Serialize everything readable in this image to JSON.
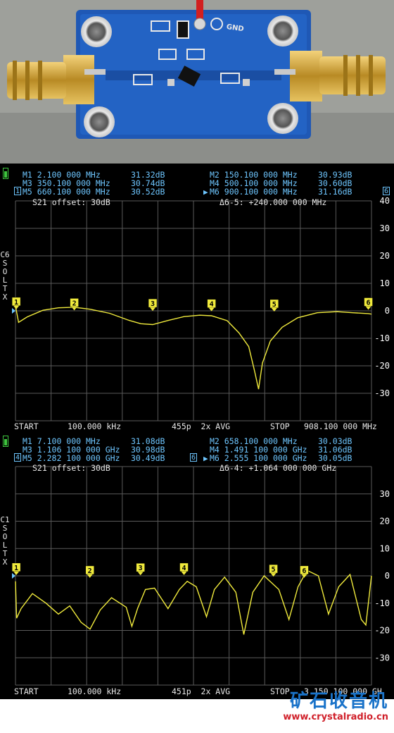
{
  "photo": {
    "pcb_label": "GND",
    "colors": {
      "board": "#1f58b5",
      "connector": "#c9a23a",
      "background": "#9d9f9b"
    }
  },
  "watermark": {
    "name": "矿石收音机",
    "url": "www.crystalradio.cn"
  },
  "screens": [
    {
      "markers_text": [
        {
          "label": "M1 2.100 000 MHz",
          "value": "31.32dB"
        },
        {
          "label": "M2 150.100 000 MHz",
          "value": "30.93dB"
        },
        {
          "label": "M3 350.100 000 MHz",
          "value": "30.74dB"
        },
        {
          "label": "M4 500.100 000 MHz",
          "value": "30.60dB"
        },
        {
          "label": "M5 660.100 000 MHz",
          "value": "30.52dB"
        },
        {
          "label": "M6 900.100 000 MHz",
          "value": "31.16dB"
        }
      ],
      "trace_info": "S21 offset: 30dB",
      "delta": "Δ6-5: +240.000 000 MHz",
      "side_label": "C6\nS\nO\nL\nT\nX",
      "start_label": "START",
      "start_value": "100.000 kHz",
      "points_avg": "455p  2x AVG",
      "stop_label": "STOP",
      "stop_value": "908.100 000 MHz",
      "active_marker": "6",
      "ref_marker": "1",
      "colors": {
        "trace": "#f0ea3c",
        "marker_text": "#6ec6ff",
        "grid": "#5a5a5a"
      },
      "chart_data": {
        "type": "line",
        "title": "",
        "xlabel": "",
        "ylabel": "",
        "x_unit": "MHz",
        "xlim": [
          0.1,
          908.1
        ],
        "ylim": [
          -40,
          40
        ],
        "y_ticks": [
          40,
          30,
          20,
          10,
          0,
          -10,
          -20,
          -30
        ],
        "grid": true,
        "series": [
          {
            "values": [
              [
                0.1,
                1.8
              ],
              [
                8,
                -4.2
              ],
              [
                30,
                -2.2
              ],
              [
                70,
                0.2
              ],
              [
                110,
                1.1
              ],
              [
                150,
                1.3
              ],
              [
                190,
                0.6
              ],
              [
                240,
                -0.9
              ],
              [
                290,
                -3.5
              ],
              [
                320,
                -4.7
              ],
              [
                350,
                -5.0
              ],
              [
                390,
                -3.5
              ],
              [
                430,
                -2.1
              ],
              [
                470,
                -1.6
              ],
              [
                500,
                -1.8
              ],
              [
                540,
                -3.6
              ],
              [
                570,
                -8.0
              ],
              [
                595,
                -13
              ],
              [
                610,
                -22
              ],
              [
                620,
                -28.5
              ],
              [
                630,
                -19
              ],
              [
                650,
                -11
              ],
              [
                680,
                -6.0
              ],
              [
                720,
                -2.5
              ],
              [
                770,
                -0.7
              ],
              [
                820,
                -0.3
              ],
              [
                860,
                -0.7
              ],
              [
                900,
                -1.0
              ],
              [
                908.1,
                -1.2
              ]
            ]
          }
        ],
        "markers": [
          {
            "id": "1",
            "x": 2.1,
            "y": 1.32
          },
          {
            "id": "2",
            "x": 150.1,
            "y": 0.93
          },
          {
            "id": "3",
            "x": 350.1,
            "y": 0.74
          },
          {
            "id": "4",
            "x": 500.1,
            "y": 0.6
          },
          {
            "id": "5",
            "x": 660.1,
            "y": 0.52
          },
          {
            "id": "6",
            "x": 900.1,
            "y": 1.16
          }
        ]
      }
    },
    {
      "markers_text": [
        {
          "label": "M1 7.100 000 MHz",
          "value": "31.08dB"
        },
        {
          "label": "M2 658.100 000 MHz",
          "value": "30.03dB"
        },
        {
          "label": "M3 1.106 100 000 GHz",
          "value": "30.98dB"
        },
        {
          "label": "M4 1.491 100 000 GHz",
          "value": "31.06dB"
        },
        {
          "label": "M5 2.282 100 000 GHz",
          "value": "30.49dB"
        },
        {
          "label": "M6 2.555 100 000 GHz",
          "value": "30.05dB"
        }
      ],
      "trace_info": "S21 offset: 30dB",
      "delta": "Δ6-4: +1.064 000 000 GHz",
      "side_label": "C1\nS\nO\nL\nT\nX",
      "start_label": "START",
      "start_value": "100.000 kHz",
      "points_avg": "451p  2x AVG",
      "stop_label": "STOP",
      "stop_value": "3.150 100 000 GH",
      "active_marker": "6",
      "ref_marker": "4",
      "colors": {
        "trace": "#f0ea3c",
        "marker_text": "#6ec6ff",
        "grid": "#5a5a5a"
      },
      "chart_data": {
        "type": "line",
        "title": "",
        "xlabel": "",
        "ylabel": "",
        "x_unit": "GHz",
        "xlim": [
          0.0001,
          3.1501
        ],
        "ylim": [
          -40,
          40
        ],
        "y_ticks": [
          30,
          20,
          10,
          0,
          -10,
          -20,
          -30
        ],
        "grid": true,
        "series": [
          {
            "values": [
              [
                0.0001,
                -2
              ],
              [
                0.01,
                -15.5
              ],
              [
                0.05,
                -12
              ],
              [
                0.15,
                -6.5
              ],
              [
                0.27,
                -10
              ],
              [
                0.38,
                -14
              ],
              [
                0.48,
                -11
              ],
              [
                0.58,
                -17
              ],
              [
                0.66,
                -19.5
              ],
              [
                0.75,
                -12.5
              ],
              [
                0.85,
                -8
              ],
              [
                0.98,
                -11.5
              ],
              [
                1.03,
                -18.5
              ],
              [
                1.08,
                -12
              ],
              [
                1.15,
                -5
              ],
              [
                1.23,
                -4.5
              ],
              [
                1.35,
                -12
              ],
              [
                1.45,
                -5
              ],
              [
                1.52,
                -2
              ],
              [
                1.6,
                -4
              ],
              [
                1.69,
                -15
              ],
              [
                1.76,
                -5
              ],
              [
                1.85,
                -0.5
              ],
              [
                1.95,
                -6
              ],
              [
                2.02,
                -21.5
              ],
              [
                2.1,
                -6
              ],
              [
                2.2,
                0
              ],
              [
                2.33,
                -5
              ],
              [
                2.42,
                -16
              ],
              [
                2.5,
                -4
              ],
              [
                2.58,
                2
              ],
              [
                2.68,
                0
              ],
              [
                2.77,
                -14
              ],
              [
                2.86,
                -4
              ],
              [
                2.96,
                0.5
              ],
              [
                3.06,
                -16
              ],
              [
                3.1,
                -18
              ],
              [
                3.15,
                0
              ]
            ]
          }
        ],
        "markers": [
          {
            "id": "1",
            "x": 0.0071,
            "y": 1.08
          },
          {
            "id": "2",
            "x": 0.6581,
            "y": 0.03
          },
          {
            "id": "3",
            "x": 1.1061,
            "y": 0.98
          },
          {
            "id": "4",
            "x": 1.4911,
            "y": 1.06
          },
          {
            "id": "5",
            "x": 2.2821,
            "y": 0.49
          },
          {
            "id": "6",
            "x": 2.5551,
            "y": 0.05
          }
        ]
      }
    }
  ]
}
